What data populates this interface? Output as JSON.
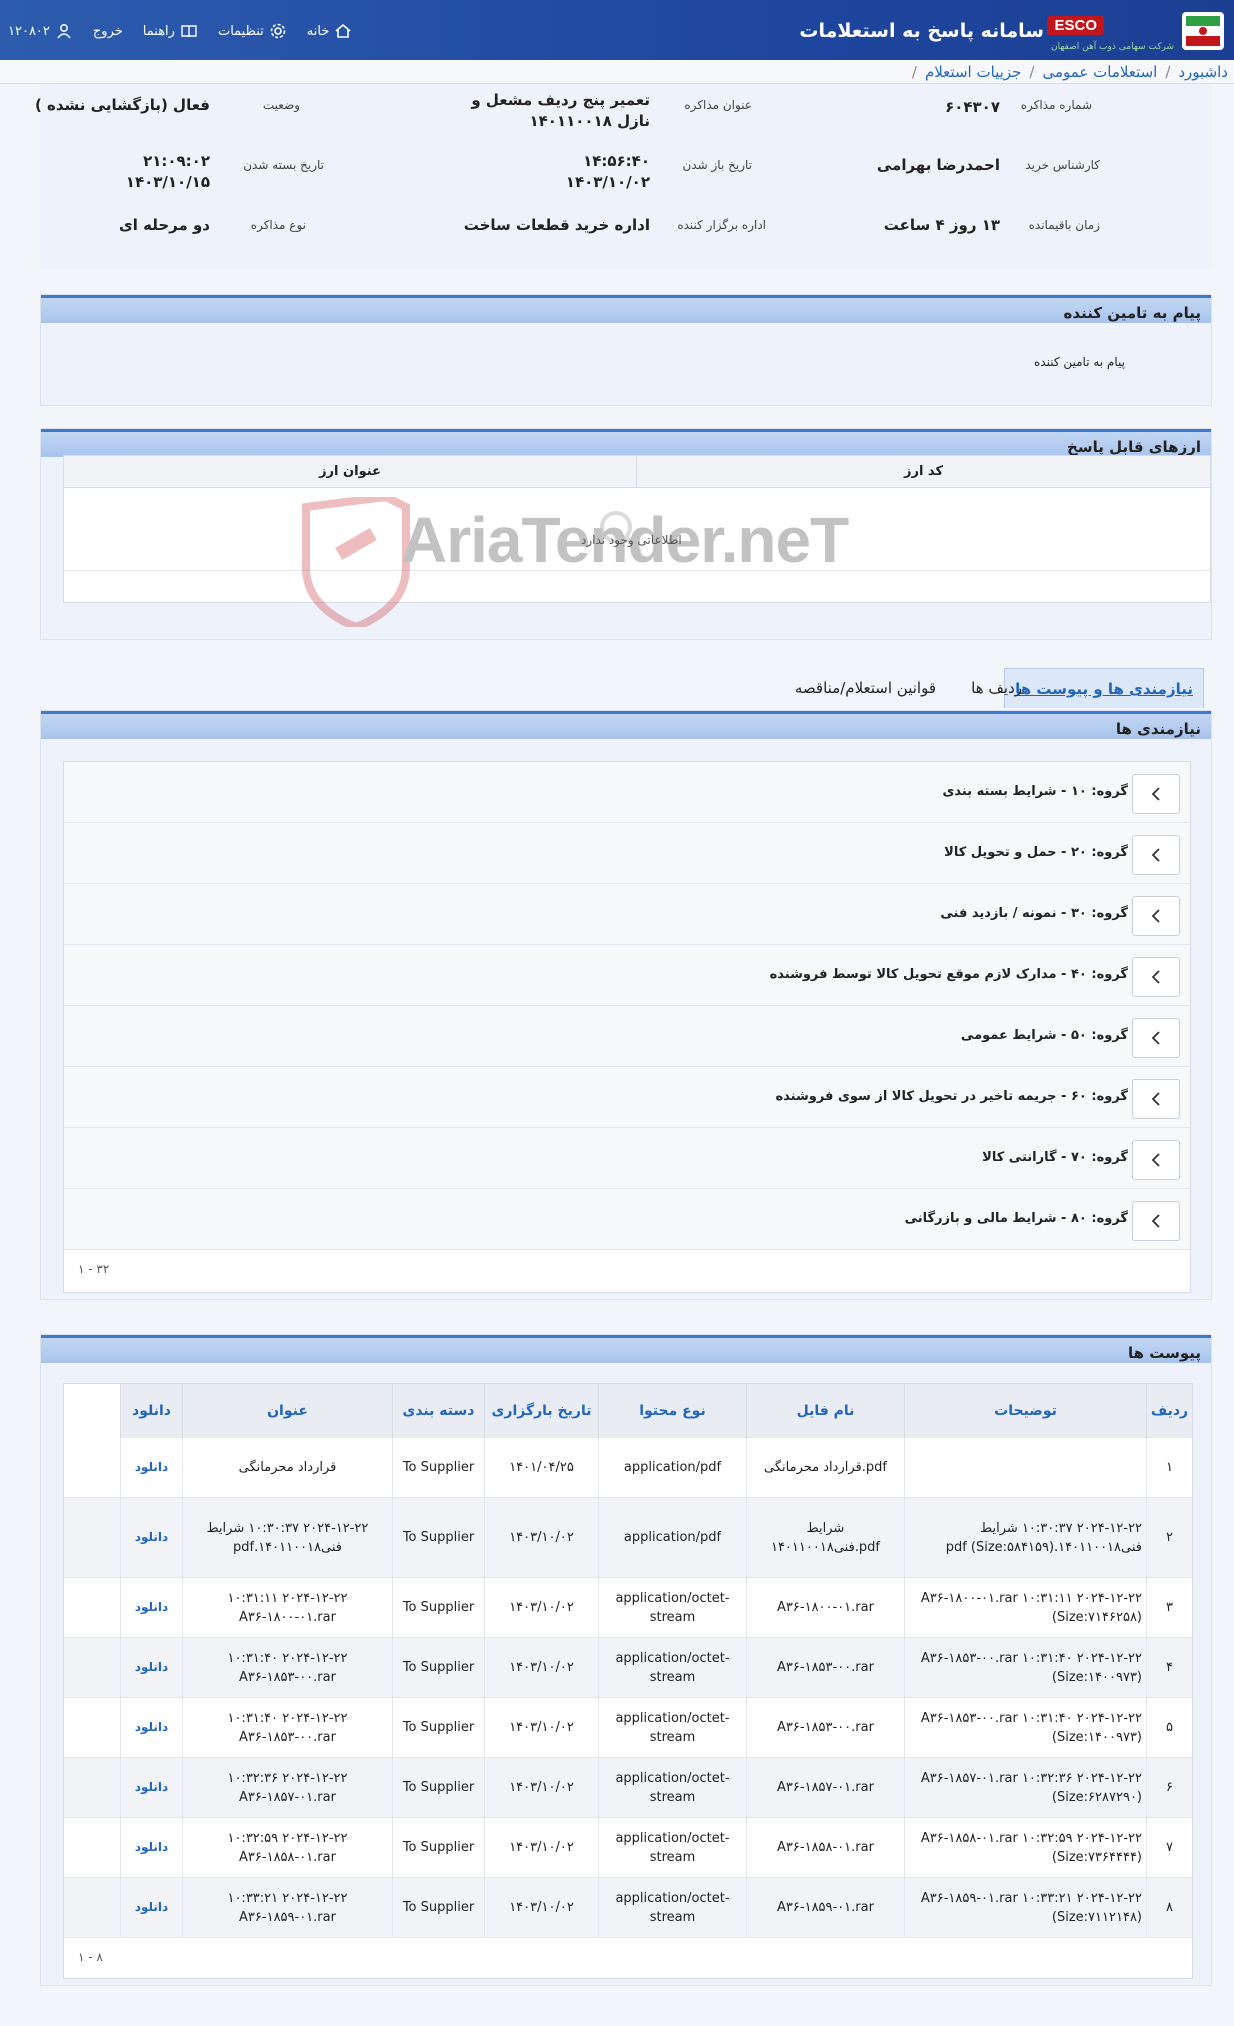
{
  "header": {
    "app_title": "سامانه پاسخ به استعلامات",
    "brand_badge": "ESCO",
    "brand_sub": "شرکت سهامی ذوب آهن اصفهان",
    "nav": [
      {
        "label": "خانه",
        "icon": "home-icon"
      },
      {
        "label": "تنظیمات",
        "icon": "gear-icon"
      },
      {
        "label": "راهنما",
        "icon": "book-icon"
      },
      {
        "label": "خروج",
        "icon": "logout-icon"
      },
      {
        "label": "۱۲۰۸۰۲",
        "icon": "user-icon"
      }
    ]
  },
  "breadcrumb": [
    "داشبورد",
    "استعلامات عمومی",
    "جزییات استعلام"
  ],
  "info": {
    "negotiation_number_label": "شماره مذاکره",
    "negotiation_number": "۶۰۴۳۰۷",
    "title_label": "عنوان مذاکره",
    "title_line1": "تعمیر پنج ردیف مشعل و",
    "title_line2": "نازل ۱۴۰۱۱۰۰۱۸",
    "status_label": "وضعیت",
    "status": "فعال (بازگشایی نشده )",
    "buyer_label": "کارشناس خرید",
    "buyer": "احمدرضا بهرامی",
    "open_date_label": "تاریخ باز شدن",
    "open_time": "۱۴:۵۶:۴۰",
    "open_date": "۱۴۰۳/۱۰/۰۲",
    "close_date_label": "تاریخ بسته شدن",
    "close_time": "۲۱:۰۹:۰۲",
    "close_date": "۱۴۰۳/۱۰/۱۵",
    "remaining_label": "زمان باقیمانده",
    "remaining": "۱۳ روز ۴ ساعت",
    "organizer_label": "اداره برگزار کننده",
    "organizer": "اداره خرید قطعات ساخت",
    "type_label": "نوع مذاکره",
    "type": "دو مرحله ای"
  },
  "message": {
    "title": "پیام به تامین کننده",
    "body": "پیام به تامین کننده"
  },
  "currency": {
    "title": "ارزهای قابل پاسخ",
    "col_code": "کد ارز",
    "col_title": "عنوان ارز",
    "empty": "اطلاعاتی وجود ندارد",
    "watermark": "AriaTender.neT"
  },
  "tabs": [
    {
      "label": "نیازمندی ها و پیوست ها",
      "active": true
    },
    {
      "label": "ردیف ها",
      "active": false
    },
    {
      "label": "قوانین استعلام/مناقصه",
      "active": false
    }
  ],
  "needs": {
    "title": "نیازمندی ها",
    "groups": [
      "گروه: ۱۰ - شرایط بسته بندی",
      "گروه: ۲۰ - حمل و تحویل کالا",
      "گروه: ۳۰ - نمونه / بازدید فنی",
      "گروه: ۴۰ - مدارک لازم موقع تحویل کالا توسط فروشنده",
      "گروه: ۵۰ - شرایط عمومی",
      "گروه: ۶۰ - جریمه تاخیر در تحویل کالا از سوی فروشنده",
      "گروه: ۷۰ - گارانتی کالا",
      "گروه: ۸۰ - شرایط مالی و بازرگانی"
    ],
    "pager": "۱ - ۳۲"
  },
  "attachments": {
    "title": "پیوست ها",
    "columns": [
      "ردیف",
      "توضیحات",
      "نام فایل",
      "نوع محتوا",
      "تاریخ بارگزاری",
      "دسته بندی",
      "عنوان",
      "دانلود"
    ],
    "rows": [
      {
        "n": "۱",
        "desc": "",
        "file": "قرارداد محرمانگی.pdf",
        "type": "application/pdf",
        "date": "۱۴۰۱/۰۴/۲۵",
        "cat": "To Supplier",
        "title": "قرارداد محرمانگی",
        "dl": "دانلود"
      },
      {
        "n": "۲",
        "desc": "۲۰۲۴-۱۲-۲۲ ۱۰:۳۰:۳۷ شرایط فنی۱۴۰۱۱۰۰۱۸.pdf (Size:۵۸۴۱۵۹)",
        "file": "شرایط فنی۱۴۰۱۱۰۰۱۸.pdf",
        "type": "application/pdf",
        "date": "۱۴۰۳/۱۰/۰۲",
        "cat": "To Supplier",
        "title": "۲۰۲۴-۱۲-۲۲ ۱۰:۳۰:۳۷ شرایط فنی۱۴۰۱۱۰۰۱۸.pdf",
        "dl": "دانلود"
      },
      {
        "n": "۳",
        "desc": "۲۰۲۴-۱۲-۲۲ ۱۰:۳۱:۱۱ A۳۶-۱۸۰۰-۰۱.rar (Size:۷۱۴۶۲۵۸)",
        "file": "A۳۶-۱۸۰۰-۰۱.rar",
        "type": "application/octet-stream",
        "date": "۱۴۰۳/۱۰/۰۲",
        "cat": "To Supplier",
        "title": "۲۰۲۴-۱۲-۲۲ ۱۰:۳۱:۱۱ A۳۶-۱۸۰۰-۰۱.rar",
        "dl": "دانلود"
      },
      {
        "n": "۴",
        "desc": "۲۰۲۴-۱۲-۲۲ ۱۰:۳۱:۴۰ A۳۶-۱۸۵۳-۰۰.rar (Size:۱۴۰۰۹۷۳)",
        "file": "A۳۶-۱۸۵۳-۰۰.rar",
        "type": "application/octet-stream",
        "date": "۱۴۰۳/۱۰/۰۲",
        "cat": "To Supplier",
        "title": "۲۰۲۴-۱۲-۲۲ ۱۰:۳۱:۴۰ A۳۶-۱۸۵۳-۰۰.rar",
        "dl": "دانلود"
      },
      {
        "n": "۵",
        "desc": "۲۰۲۴-۱۲-۲۲ ۱۰:۳۱:۴۰ A۳۶-۱۸۵۳-۰۰.rar (Size:۱۴۰۰۹۷۳)",
        "file": "A۳۶-۱۸۵۳-۰۰.rar",
        "type": "application/octet-stream",
        "date": "۱۴۰۳/۱۰/۰۲",
        "cat": "To Supplier",
        "title": "۲۰۲۴-۱۲-۲۲ ۱۰:۳۱:۴۰ A۳۶-۱۸۵۳-۰۰.rar",
        "dl": "دانلود"
      },
      {
        "n": "۶",
        "desc": "۲۰۲۴-۱۲-۲۲ ۱۰:۳۲:۳۶ A۳۶-۱۸۵۷-۰۱.rar (Size:۶۲۸۷۲۹۰)",
        "file": "A۳۶-۱۸۵۷-۰۱.rar",
        "type": "application/octet-stream",
        "date": "۱۴۰۳/۱۰/۰۲",
        "cat": "To Supplier",
        "title": "۲۰۲۴-۱۲-۲۲ ۱۰:۳۲:۳۶ A۳۶-۱۸۵۷-۰۱.rar",
        "dl": "دانلود"
      },
      {
        "n": "۷",
        "desc": "۲۰۲۴-۱۲-۲۲ ۱۰:۳۲:۵۹ A۳۶-۱۸۵۸-۰۱.rar (Size:۷۳۶۴۴۴۴)",
        "file": "A۳۶-۱۸۵۸-۰۱.rar",
        "type": "application/octet-stream",
        "date": "۱۴۰۳/۱۰/۰۲",
        "cat": "To Supplier",
        "title": "۲۰۲۴-۱۲-۲۲ ۱۰:۳۲:۵۹ A۳۶-۱۸۵۸-۰۱.rar",
        "dl": "دانلود"
      },
      {
        "n": "۸",
        "desc": "۲۰۲۴-۱۲-۲۲ ۱۰:۳۳:۲۱ A۳۶-۱۸۵۹-۰۱.rar (Size:۷۱۱۲۱۴۸)",
        "file": "A۳۶-۱۸۵۹-۰۱.rar",
        "type": "application/octet-stream",
        "date": "۱۴۰۳/۱۰/۰۲",
        "cat": "To Supplier",
        "title": "۲۰۲۴-۱۲-۲۲ ۱۰:۳۳:۲۱ A۳۶-۱۸۵۹-۰۱.rar",
        "dl": "دانلود"
      }
    ],
    "pager": "۱ - ۸"
  }
}
